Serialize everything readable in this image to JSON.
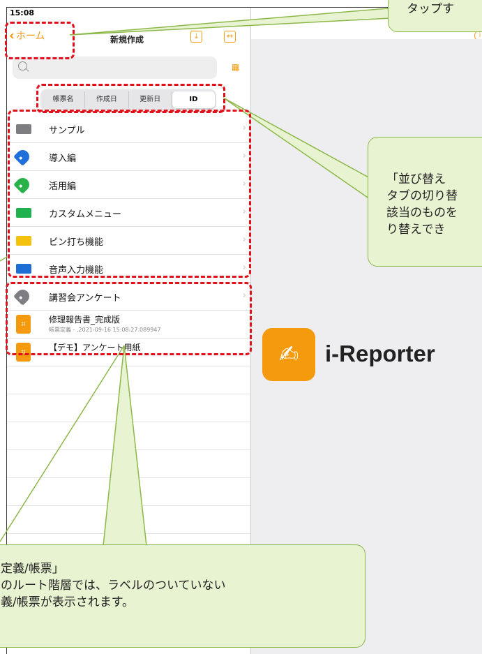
{
  "status": {
    "time": "15:08"
  },
  "nav": {
    "back_label": "ホーム",
    "title": "新規作成"
  },
  "search": {
    "placeholder": ""
  },
  "segments": [
    {
      "label": "帳票名"
    },
    {
      "label": "作成日"
    },
    {
      "label": "更新日"
    },
    {
      "label": "ID"
    }
  ],
  "folders": [
    {
      "label": "サンプル",
      "icon": "folder-icon",
      "color": "#7d7d82"
    },
    {
      "label": "導入編",
      "icon": "tag-icon",
      "color": "#1e6fd9"
    },
    {
      "label": "活用編",
      "icon": "tag-icon",
      "color": "#2ab24a"
    },
    {
      "label": "カスタムメニュー",
      "icon": "folder-icon",
      "color": "#1fb14e"
    },
    {
      "label": "ピン打ち機能",
      "icon": "folder-icon",
      "color": "#f4c20d"
    },
    {
      "label": "音声入力機能",
      "icon": "folder-icon",
      "color": "#1d6fd6"
    },
    {
      "label": "講習会アンケート",
      "icon": "tag-icon",
      "color": "#7d7d82"
    }
  ],
  "documents": [
    {
      "title": "修理報告書_完成版",
      "subtitle": "帳票定義 - ,2021-09-16 15:08:27.089947"
    },
    {
      "title": "【デモ】アンケート用紙",
      "subtitle": ""
    }
  ],
  "brand": {
    "name": "i-Reporter"
  },
  "callouts": {
    "top": "タップす",
    "middle": "「並び替え\nタブの切り替\n該当のものを\nり替えでき",
    "bottom": "定義/帳票」\nのルート階層では、ラベルのついていない\n義/帳票が表示されます。"
  },
  "colors": {
    "accent": "#f59a0c",
    "highlight": "#e0111a",
    "callout_bg": "#e8f3d2",
    "callout_border": "#8cb84a"
  }
}
